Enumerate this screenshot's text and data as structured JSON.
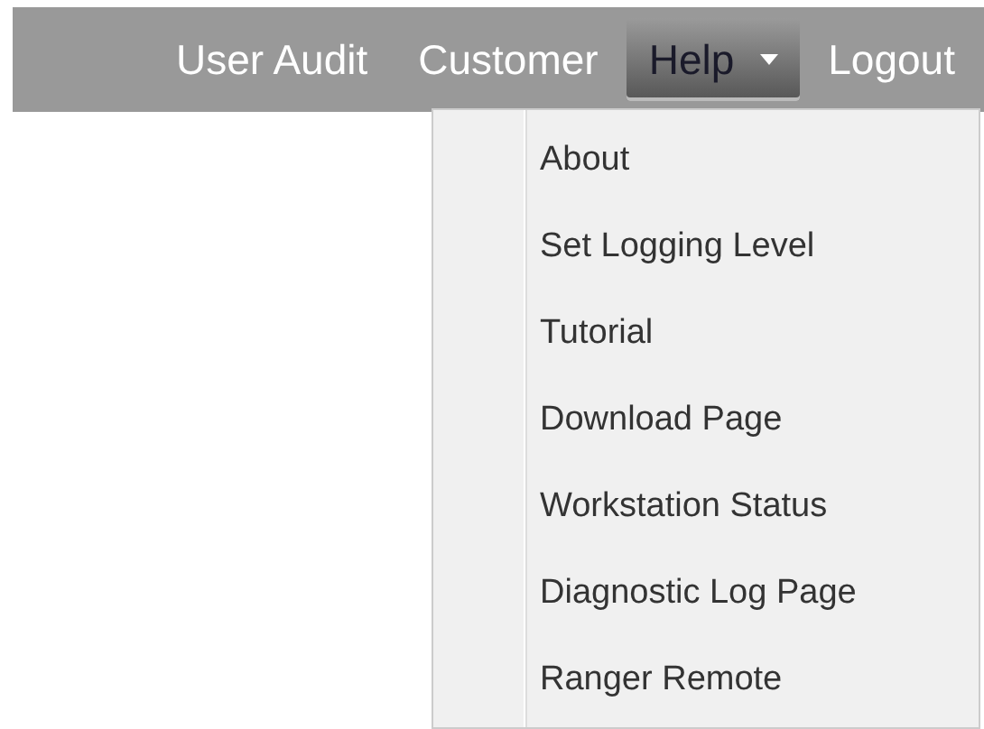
{
  "nav": [
    {
      "label": "User Audit",
      "selected": false,
      "has_dropdown": false
    },
    {
      "label": "Customer",
      "selected": false,
      "has_dropdown": false
    },
    {
      "label": "Help",
      "selected": true,
      "has_dropdown": true
    },
    {
      "label": "Logout",
      "selected": false,
      "has_dropdown": false
    }
  ],
  "help_menu": {
    "items": [
      {
        "label": "About"
      },
      {
        "label": "Set Logging Level"
      },
      {
        "label": "Tutorial"
      },
      {
        "label": "Download Page"
      },
      {
        "label": "Workstation Status"
      },
      {
        "label": "Diagnostic Log Page"
      },
      {
        "label": "Ranger Remote"
      }
    ]
  }
}
